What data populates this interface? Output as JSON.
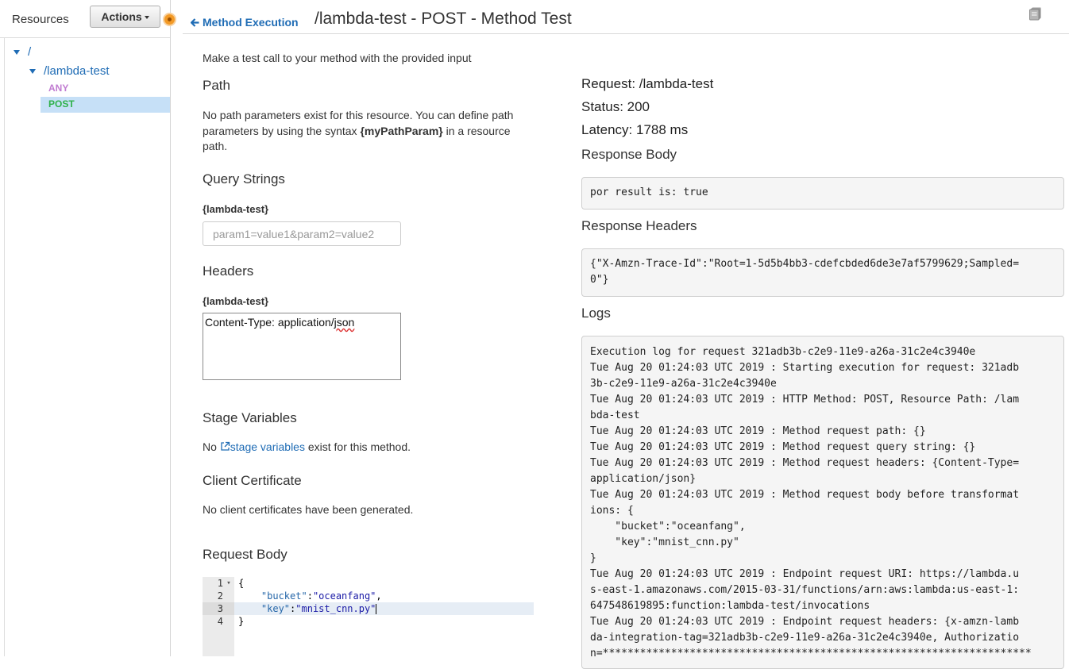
{
  "sidebar": {
    "title": "Resources",
    "actions_label": "Actions",
    "tree": {
      "root": "/",
      "resource": "/lambda-test",
      "methods": [
        "ANY",
        "POST"
      ]
    }
  },
  "header": {
    "back_label": "Method Execution",
    "title": "/lambda-test - POST - Method Test"
  },
  "test_form": {
    "intro": "Make a test call to your method with the provided input",
    "path": {
      "heading": "Path",
      "text_before": "No path parameters exist for this resource. You can define path parameters by using the syntax ",
      "syntax": "{myPathParam}",
      "text_after": " in a resource path."
    },
    "query_strings": {
      "heading": "Query Strings",
      "label": "{lambda-test}",
      "value": "",
      "placeholder": "param1=value1&param2=value2"
    },
    "headers": {
      "heading": "Headers",
      "label": "{lambda-test}",
      "value_before": "Content-Type: application/",
      "value_misspelled": "json"
    },
    "stage_variables": {
      "heading": "Stage Variables",
      "text_before": "No ",
      "link": "stage variables",
      "text_after": " exist for this method."
    },
    "client_certificate": {
      "heading": "Client Certificate",
      "text": "No client certificates have been generated."
    },
    "request_body": {
      "heading": "Request Body",
      "lines": [
        {
          "num": "1",
          "text": "{"
        },
        {
          "num": "2",
          "key": "\"bucket\"",
          "value": "\"oceanfang\"",
          "trail": ","
        },
        {
          "num": "3",
          "key": "\"key\"",
          "value": "\"mnist_cnn.py\"",
          "trail": ""
        },
        {
          "num": "4",
          "text": "}"
        }
      ]
    }
  },
  "result": {
    "request": "Request: /lambda-test",
    "status": "Status: 200",
    "latency": "Latency: 1788 ms",
    "response_body_heading": "Response Body",
    "response_body": "por result is: true",
    "response_headers_heading": "Response Headers",
    "response_headers": "{\"X-Amzn-Trace-Id\":\"Root=1-5d5b4bb3-cdefcbded6de3e7af5799629;Sampled=\n0\"}",
    "logs_heading": "Logs",
    "logs": "Execution log for request 321adb3b-c2e9-11e9-a26a-31c2e4c3940e\nTue Aug 20 01:24:03 UTC 2019 : Starting execution for request: 321adb\n3b-c2e9-11e9-a26a-31c2e4c3940e\nTue Aug 20 01:24:03 UTC 2019 : HTTP Method: POST, Resource Path: /lam\nbda-test\nTue Aug 20 01:24:03 UTC 2019 : Method request path: {}\nTue Aug 20 01:24:03 UTC 2019 : Method request query string: {}\nTue Aug 20 01:24:03 UTC 2019 : Method request headers: {Content-Type=\napplication/json}\nTue Aug 20 01:24:03 UTC 2019 : Method request body before transformat\nions: {\n    \"bucket\":\"oceanfang\",\n    \"key\":\"mnist_cnn.py\"\n}\nTue Aug 20 01:24:03 UTC 2019 : Endpoint request URI: https://lambda.u\ns-east-1.amazonaws.com/2015-03-31/functions/arn:aws:lambda:us-east-1:\n647548619895:function:lambda-test/invocations\nTue Aug 20 01:24:03 UTC 2019 : Endpoint request headers: {x-amzn-lamb\nda-integration-tag=321adb3b-c2e9-11e9-a26a-31c2e4c3940e, Authorizatio\nn=*********************************************************************"
  },
  "colors": {
    "link": "#1f6cb5",
    "any_method": "#c07bd1",
    "post_method": "#2fb14a",
    "selected_row": "#c6e0f7"
  },
  "icons": {
    "back": "arrow-left-icon",
    "docs": "book-icon",
    "external": "external-link-icon",
    "expand": "triangle-down-icon"
  }
}
